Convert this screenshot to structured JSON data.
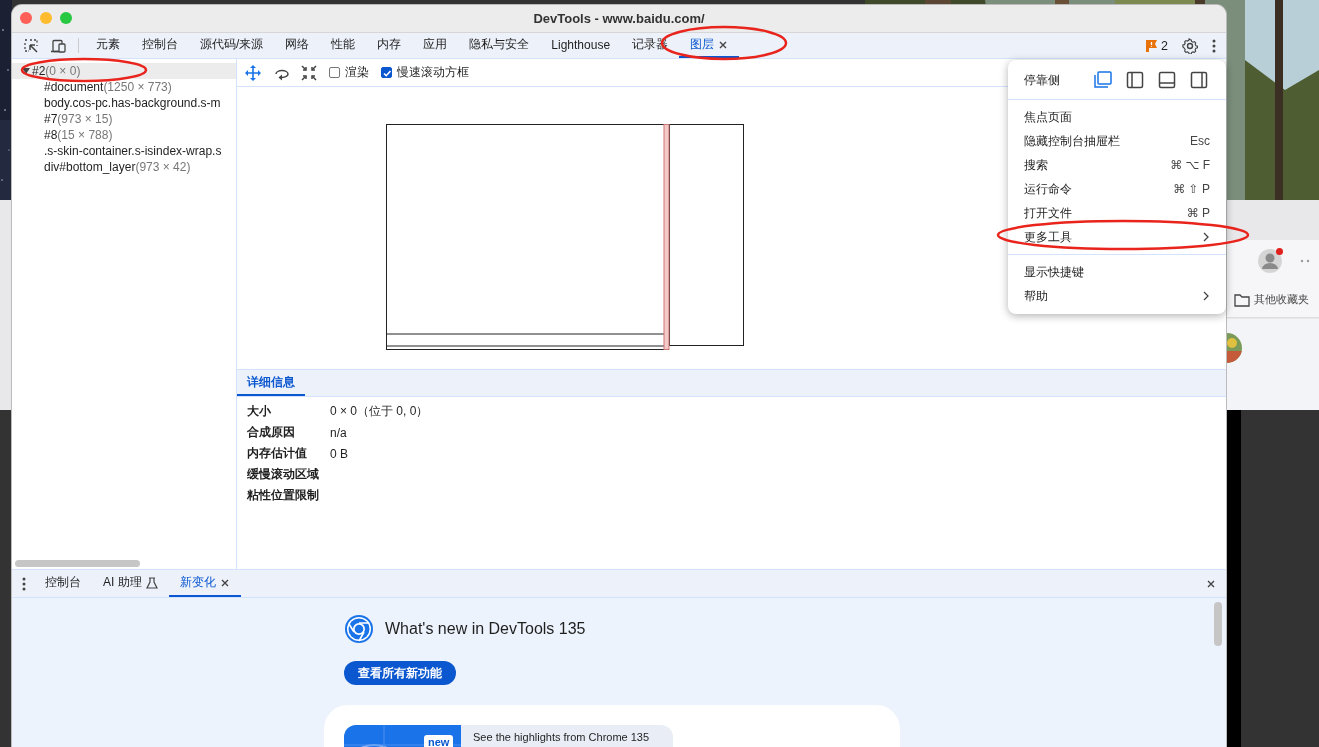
{
  "window": {
    "title": "DevTools - www.baidu.com/"
  },
  "main_tabs": [
    {
      "label": "元素",
      "selected": false,
      "closable": false
    },
    {
      "label": "控制台",
      "selected": false,
      "closable": false
    },
    {
      "label": "源代码/来源",
      "selected": false,
      "closable": false
    },
    {
      "label": "网络",
      "selected": false,
      "closable": false
    },
    {
      "label": "性能",
      "selected": false,
      "closable": false
    },
    {
      "label": "内存",
      "selected": false,
      "closable": false
    },
    {
      "label": "应用",
      "selected": false,
      "closable": false
    },
    {
      "label": "隐私与安全",
      "selected": false,
      "closable": false
    },
    {
      "label": "Lighthouse",
      "selected": false,
      "closable": false
    },
    {
      "label": "记录器",
      "selected": false,
      "closable": false
    },
    {
      "label": "图层",
      "selected": true,
      "closable": true
    }
  ],
  "issues": {
    "count": "2"
  },
  "layer_tree": [
    {
      "name": "#2",
      "size": "(0 × 0)",
      "selected": true,
      "expanded": true,
      "children": [
        {
          "name": "#document",
          "size": "(1250 × 773)",
          "selected": false
        },
        {
          "name": "body.cos-pc.has-background.s-m",
          "selected": false
        },
        {
          "name": "#7",
          "size": "(973 × 15)",
          "selected": false
        },
        {
          "name": "#8",
          "size": "(15 × 788)",
          "selected": false
        },
        {
          "name": ".s-skin-container.s-isindex-wrap.s",
          "selected": false
        },
        {
          "name": "div#bottom_layer",
          "size": "(973 × 42)",
          "selected": false
        }
      ]
    }
  ],
  "layer_toolbar": {
    "checkboxes": [
      {
        "label": "渲染",
        "checked": false
      },
      {
        "label": "慢速滚动方框",
        "checked": true
      }
    ]
  },
  "details": {
    "tab": "详细信息",
    "rows": [
      {
        "label": "大小",
        "value": "0 × 0（位于 0, 0）"
      },
      {
        "label": "合成原因",
        "value": "n/a"
      },
      {
        "label": "内存估计值",
        "value": "0 B"
      },
      {
        "label": "缓慢滚动区域"
      },
      {
        "label": "粘性位置限制"
      }
    ]
  },
  "drawer": {
    "tabs": [
      {
        "label": "控制台",
        "selected": false,
        "closable": false,
        "experimental": false
      },
      {
        "label": "AI 助理",
        "selected": false,
        "closable": false,
        "experimental": true
      },
      {
        "label": "新变化",
        "selected": true,
        "closable": true,
        "experimental": false
      }
    ],
    "whats_new": {
      "title": "What's new in DevTools 135",
      "button": "查看所有新功能",
      "card": {
        "badge": "new",
        "text": "See the highlights from Chrome 135"
      }
    }
  },
  "menu": {
    "dock_label": "停靠侧",
    "dock_options": [
      {
        "kind": "undock",
        "selected": true
      },
      {
        "kind": "left",
        "selected": false
      },
      {
        "kind": "bottom",
        "selected": false
      },
      {
        "kind": "right",
        "selected": false
      }
    ],
    "groups": [
      [
        {
          "label": "焦点页面",
          "submenu": false
        },
        {
          "label": "隐藏控制台抽屉栏",
          "shortcut": "Esc",
          "submenu": false
        },
        {
          "label": "搜索",
          "shortcut": "⌘ ⌥ F",
          "submenu": false
        },
        {
          "label": "运行命令",
          "shortcut": "⌘ ⇧ P",
          "submenu": false
        },
        {
          "label": "打开文件",
          "shortcut": "⌘ P",
          "submenu": false
        },
        {
          "label": "更多工具",
          "submenu": true
        }
      ],
      [
        {
          "label": "显示快捷键",
          "submenu": false
        },
        {
          "label": "帮助",
          "submenu": true
        }
      ]
    ]
  },
  "background_browser": {
    "profile_notification": true,
    "bookmark": "其他收藏夹"
  }
}
